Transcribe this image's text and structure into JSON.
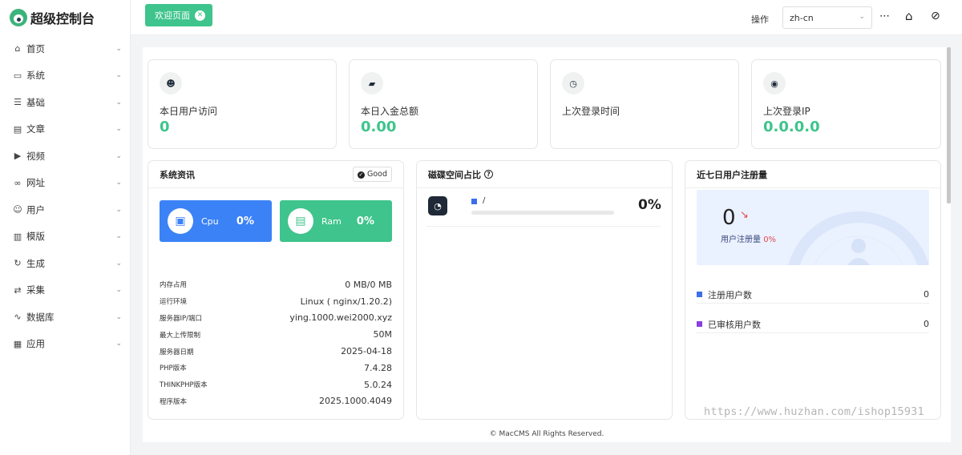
{
  "app": {
    "title": "超级控制台"
  },
  "sidebar": {
    "items": [
      {
        "icon": "home-icon",
        "glyph": "⌂",
        "label": "首页"
      },
      {
        "icon": "monitor-icon",
        "glyph": "▭",
        "label": "系统"
      },
      {
        "icon": "list-icon",
        "glyph": "☰",
        "label": "基础"
      },
      {
        "icon": "document-icon",
        "glyph": "▤",
        "label": "文章"
      },
      {
        "icon": "play-icon",
        "glyph": "▶",
        "label": "视频"
      },
      {
        "icon": "link-icon",
        "glyph": "∞",
        "label": "网址"
      },
      {
        "icon": "user-icon",
        "glyph": "☺",
        "label": "用户"
      },
      {
        "icon": "template-icon",
        "glyph": "▥",
        "label": "模版"
      },
      {
        "icon": "generate-icon",
        "glyph": "↻",
        "label": "生成"
      },
      {
        "icon": "collect-icon",
        "glyph": "⇄",
        "label": "采集"
      },
      {
        "icon": "chart-icon",
        "glyph": "∿",
        "label": "数据库"
      },
      {
        "icon": "apps-icon",
        "glyph": "▦",
        "label": "应用"
      }
    ]
  },
  "topbar": {
    "tab_label": "欢迎页面",
    "operate_label": "操作",
    "lang_value": "zh-cn"
  },
  "stats": [
    {
      "icon": "user-icon",
      "glyph": "☻",
      "title": "本日用户访问",
      "value": "0"
    },
    {
      "icon": "wallet-icon",
      "glyph": "▰",
      "title": "本日入金总额",
      "value": "0.00"
    },
    {
      "icon": "clock-icon",
      "glyph": "◷",
      "title": "上次登录时间",
      "value": ""
    },
    {
      "icon": "location-icon",
      "glyph": "◉",
      "title": "上次登录IP",
      "value": "0.0.0.0"
    }
  ],
  "sysinfo": {
    "title": "系统资讯",
    "badge": "Good",
    "cpu": {
      "label": "Cpu",
      "value": "0%"
    },
    "ram": {
      "label": "Ram",
      "value": "0%"
    },
    "rows": [
      {
        "k": "内存占用",
        "v": "0 MB/0 MB"
      },
      {
        "k": "运行环境",
        "v": "Linux ( nginx/1.20.2)"
      },
      {
        "k": "服务器IP/端口",
        "v": "ying.1000.wei2000.xyz"
      },
      {
        "k": "最大上传限制",
        "v": "50M"
      },
      {
        "k": "服务器日期",
        "v": "2025-04-18"
      },
      {
        "k": "PHP版本",
        "v": "7.4.28"
      },
      {
        "k": "THINKPHP版本",
        "v": "5.0.24"
      },
      {
        "k": "程序版本",
        "v": "2025.1000.4049"
      }
    ]
  },
  "disk": {
    "title": "磁碟空间占比",
    "path": "/",
    "percent": "0%",
    "fill": 0
  },
  "registrations": {
    "title": "近七日用户注册量",
    "count": "0",
    "label": "用户注册量",
    "percent": "0%",
    "legend": [
      {
        "label": "注册用户数",
        "value": "0",
        "color": "#3b6ee8"
      },
      {
        "label": "已审核用户数",
        "value": "0",
        "color": "#8a3fe0"
      }
    ]
  },
  "footer": "© MacCMS All Rights Reserved.",
  "watermark": "https://www.huzhan.com/ishop15931"
}
